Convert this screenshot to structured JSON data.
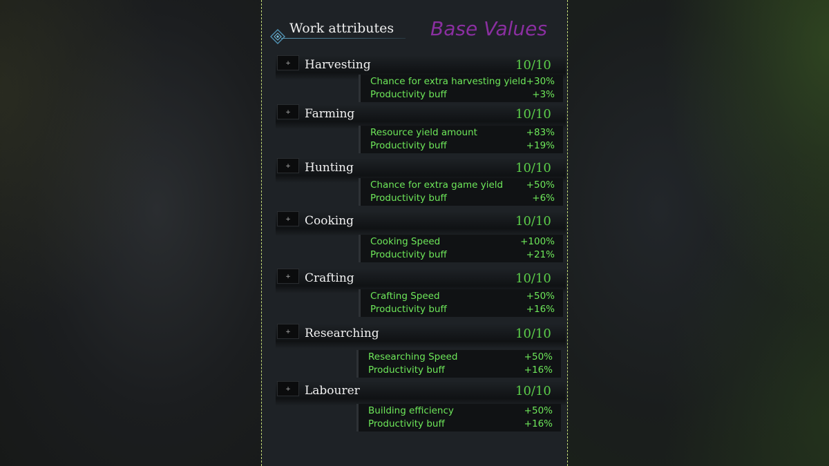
{
  "header": {
    "title": "Work attributes",
    "overlay": "Base Values"
  },
  "attributes": [
    {
      "name": "Harvesting",
      "level": "10/10",
      "plus": "+",
      "effects": [
        {
          "label": "Chance for extra harvesting yield",
          "value": "+30%"
        },
        {
          "label": "Productivity buff",
          "value": "+3%"
        }
      ]
    },
    {
      "name": "Farming",
      "level": "10/10",
      "plus": "+",
      "effects": [
        {
          "label": "Resource yield amount",
          "value": "+83%"
        },
        {
          "label": "Productivity buff",
          "value": "+19%"
        }
      ]
    },
    {
      "name": "Hunting",
      "level": "10/10",
      "plus": "+",
      "effects": [
        {
          "label": "Chance for extra game yield",
          "value": "+50%"
        },
        {
          "label": "Productivity buff",
          "value": "+6%"
        }
      ]
    },
    {
      "name": "Cooking",
      "level": "10/10",
      "plus": "+",
      "effects": [
        {
          "label": "Cooking Speed",
          "value": "+100%"
        },
        {
          "label": "Productivity buff",
          "value": "+21%"
        }
      ]
    },
    {
      "name": "Crafting",
      "level": "10/10",
      "plus": "+",
      "effects": [
        {
          "label": "Crafting Speed",
          "value": "+50%"
        },
        {
          "label": "Productivity buff",
          "value": "+16%"
        }
      ]
    },
    {
      "name": "Researching",
      "level": "10/10",
      "plus": "+",
      "effects": [
        {
          "label": "Researching Speed",
          "value": "+50%"
        },
        {
          "label": "Productivity buff",
          "value": "+16%"
        }
      ]
    },
    {
      "name": "Labourer",
      "level": "10/10",
      "plus": "+",
      "effects": [
        {
          "label": "Building efficiency",
          "value": "+50%"
        },
        {
          "label": "Productivity buff",
          "value": "+16%"
        }
      ]
    }
  ]
}
